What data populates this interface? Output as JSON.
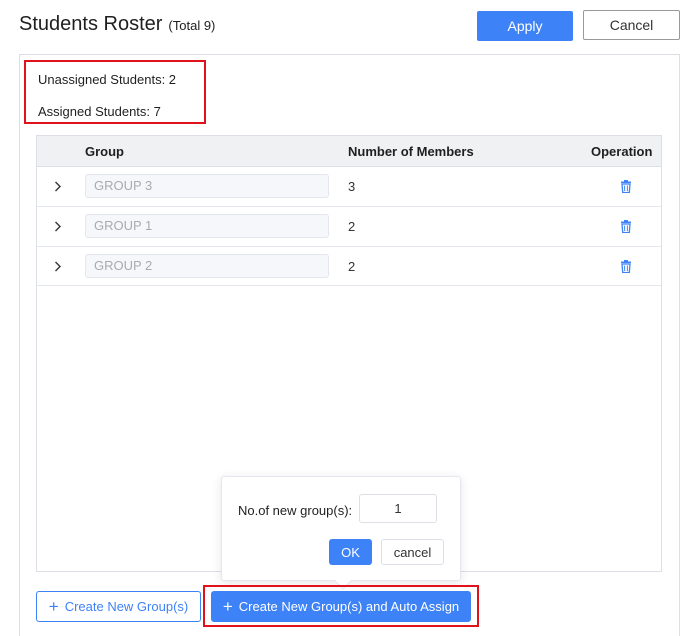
{
  "header": {
    "title": "Students Roster",
    "total": "(Total 9)",
    "apply_label": "Apply",
    "cancel_label": "Cancel"
  },
  "stats": {
    "unassigned": "Unassigned Students: 2",
    "assigned": "Assigned Students: 7"
  },
  "table": {
    "columns": [
      "Group",
      "Number of Members",
      "Operation"
    ],
    "rows": [
      {
        "group": "GROUP 3",
        "members": "3"
      },
      {
        "group": "GROUP 1",
        "members": "2"
      },
      {
        "group": "GROUP 2",
        "members": "2"
      }
    ]
  },
  "popover": {
    "label": "No.of new group(s):",
    "value": "1",
    "ok_label": "OK",
    "cancel_label": "cancel"
  },
  "footer": {
    "create_label": "Create New Group(s)",
    "auto_assign_label": "Create New Group(s) and Auto Assign"
  },
  "colors": {
    "primary": "#3e82f7",
    "highlight": "#e0131b"
  }
}
